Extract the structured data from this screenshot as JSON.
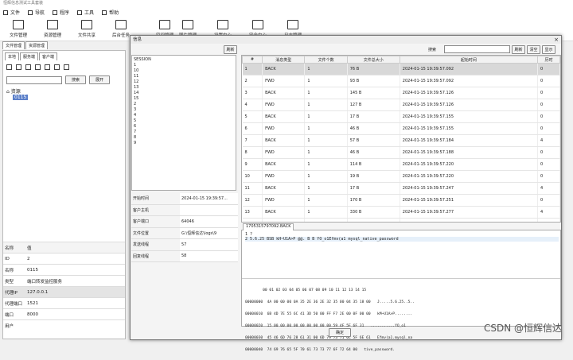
{
  "titlebar": {
    "title": "恒辉信息测试工具套装"
  },
  "menu": [
    "文件",
    "导航",
    "程序",
    "工具",
    "帮助"
  ],
  "toolbar": [
    "文件管理",
    "资源管理",
    "文件共享",
    "后台任务",
    "空间管理",
    "图片管理",
    "设置中心",
    "安全中心",
    "日志管理"
  ],
  "lefttabs": [
    "文件管理",
    "资源管理"
  ],
  "left": {
    "tabs": [
      "本地",
      "服务端",
      "客户端"
    ],
    "search_button": "搜索",
    "expand_button": "展开",
    "tree_root": "资源",
    "tree_node": "0115",
    "props_header": {
      "name": "名称",
      "value": "值"
    },
    "props": [
      [
        "ID",
        "2"
      ],
      [
        "名称",
        "0115"
      ],
      [
        "类型",
        "端口转发监控服务"
      ],
      [
        "代理IP",
        "127.0.0.1"
      ],
      [
        "代理端口",
        "1521"
      ],
      [
        "端口",
        "8000"
      ],
      [
        "用户",
        ""
      ]
    ]
  },
  "dialog": {
    "title": "信息",
    "refresh": "刷新",
    "search_label": "搜索",
    "clear_btn": "清空",
    "show_btn": "显示",
    "sessions": [
      "SESSION",
      "1",
      "10",
      "11",
      "12",
      "13",
      "14",
      "15",
      "2",
      "3",
      "4",
      "5",
      "6",
      "7",
      "8",
      "9"
    ],
    "info": [
      [
        "开始时间",
        "2024-01-15 19:39:57..."
      ],
      [
        "客户主机",
        ""
      ],
      [
        "客户端口",
        "64046"
      ],
      [
        "文件位置",
        "G:\\恒辉信达\\logs\\9"
      ],
      [
        "发送线程",
        "57"
      ],
      [
        "回复线程",
        "58"
      ]
    ],
    "columns": [
      "#",
      "消息类型",
      "文件个数",
      "文件总大小",
      "起始时间",
      "历时"
    ],
    "rows": [
      [
        "1",
        "BACK",
        "1",
        "76 B",
        "2024-01-15 19:39:57.092",
        "0"
      ],
      [
        "2",
        "FWD",
        "1",
        "93 B",
        "2024-01-15 19:39:57.092",
        "0"
      ],
      [
        "3",
        "BACK",
        "1",
        "145 B",
        "2024-01-15 19:39:57.126",
        "0"
      ],
      [
        "4",
        "FWD",
        "1",
        "127 B",
        "2024-01-15 19:39:57.126",
        "0"
      ],
      [
        "5",
        "BACK",
        "1",
        "17 B",
        "2024-01-15 19:39:57.155",
        "0"
      ],
      [
        "6",
        "FWD",
        "1",
        "46 B",
        "2024-01-15 19:39:57.155",
        "0"
      ],
      [
        "7",
        "BACK",
        "1",
        "57 B",
        "2024-01-15 19:39:57.184",
        "4"
      ],
      [
        "8",
        "FWD",
        "1",
        "46 B",
        "2024-01-15 19:39:57.188",
        "0"
      ],
      [
        "9",
        "BACK",
        "1",
        "114 B",
        "2024-01-15 19:39:57.220",
        "0"
      ],
      [
        "10",
        "FWD",
        "1",
        "19 B",
        "2024-01-15 19:39:57.220",
        "0"
      ],
      [
        "11",
        "BACK",
        "1",
        "17 B",
        "2024-01-15 19:39:57.247",
        "4"
      ],
      [
        "12",
        "FWD",
        "1",
        "170 B",
        "2024-01-15 19:39:57.251",
        "0"
      ],
      [
        "13",
        "BACK",
        "1",
        "330 B",
        "2024-01-15 19:39:57.277",
        "4"
      ],
      [
        "14",
        "FWD",
        "1",
        "17 B",
        "2024-01-15 19:39:57.281",
        "0"
      ]
    ],
    "hex_tab": "1705315797092.BACK",
    "text_lines": [
      "1 ?",
      "2 5.6.25 BSB kH~U1A>P @@.  B B           YO_o1Efmv(a1 mysql_native_password"
    ],
    "hex_header": "        00 01 02 03 04 05 06 07 08 09 10 11 12 13 14 15",
    "hex_lines": [
      "00000000  4A 00 00 00 0A 35 2E 36 2E 32 35 00 04 35 18 00   J.....5.6.25..5..",
      "00000010  6B 4D 7E 55 6C 41 3D 50 00 FF F7 2E 00 0F 00 00   kM~U1A>P........",
      "00000020  15 00 00 00 00 00 00 00 00 00 59 4F 5F 6F 31   ...........YO_o1",
      "00000030  45 46 6D 76 28 61 31 00 6D 79 73 71 6C 5F 6E 61   Efmv(a1.mysql_na",
      "00000040  74 69 76 65 5F 70 61 73 73 77 6F 72 64 00   tive_password."
    ],
    "ok": "确定"
  },
  "watermark": "CSDN @恒辉信达"
}
